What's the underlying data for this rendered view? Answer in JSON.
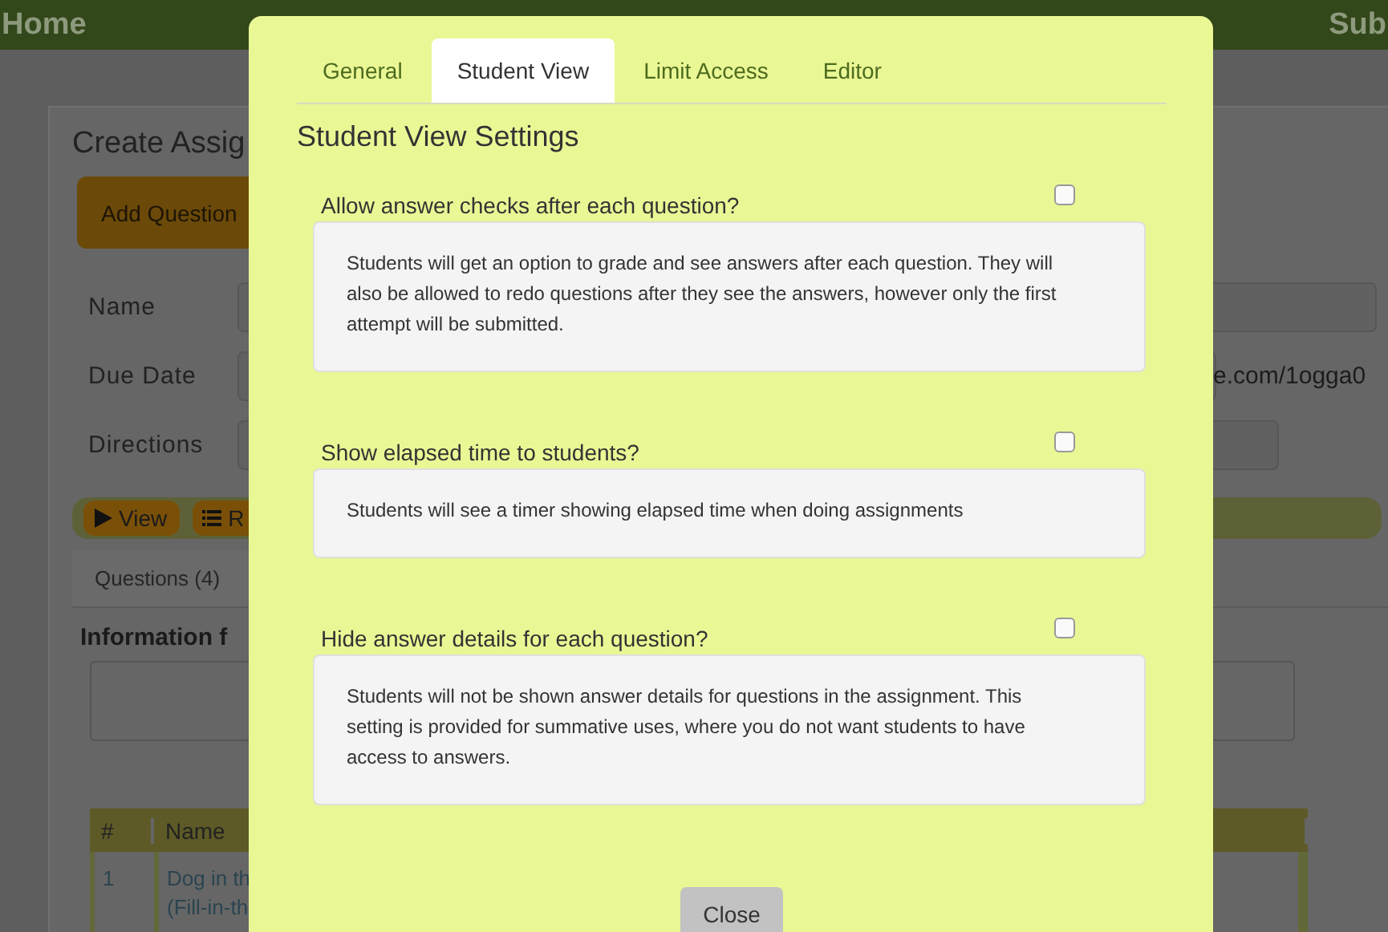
{
  "nav": {
    "left": "Home",
    "right": "Sub"
  },
  "page": {
    "title": "Create Assig",
    "add_button": "Add Question",
    "fields": [
      {
        "label": "Name"
      },
      {
        "label": "Due Date",
        "note": "e.com/1ogga0"
      },
      {
        "label": "Directions"
      }
    ],
    "toolbar": [
      {
        "kind": "play",
        "label": "View"
      },
      {
        "kind": "list",
        "label": "R"
      }
    ],
    "tab": "Questions (4)",
    "info_heading": "Information f",
    "table": {
      "columns": [
        "#",
        "Name"
      ],
      "rows": [
        {
          "cells": [
            [
              "1"
            ],
            [
              "Dog in th",
              "(Fill-in-th"
            ]
          ]
        }
      ]
    }
  },
  "modal": {
    "tabs": [
      {
        "label": "General",
        "selected": false
      },
      {
        "label": "Student View",
        "selected": true
      },
      {
        "label": "Limit Access",
        "selected": false
      },
      {
        "label": "Editor",
        "selected": false
      }
    ],
    "heading": "Student View Settings",
    "settings": [
      {
        "question": "Allow answer checks after each question?",
        "checked": false,
        "description": "Students will get an option to grade and see answers after each question. They will also be allowed to redo questions after they see the answers, however only the first attempt will be submitted."
      },
      {
        "question": "Show elapsed time to students?",
        "checked": false,
        "description": "Students will see a timer showing elapsed time when doing assignments"
      },
      {
        "question": "Hide answer details for each question?",
        "checked": false,
        "description": "Students will not be shown answer details for questions in the assignment. This setting is provided for summative uses, where you do not want students to have access to answers."
      }
    ],
    "close_button": "Close"
  }
}
